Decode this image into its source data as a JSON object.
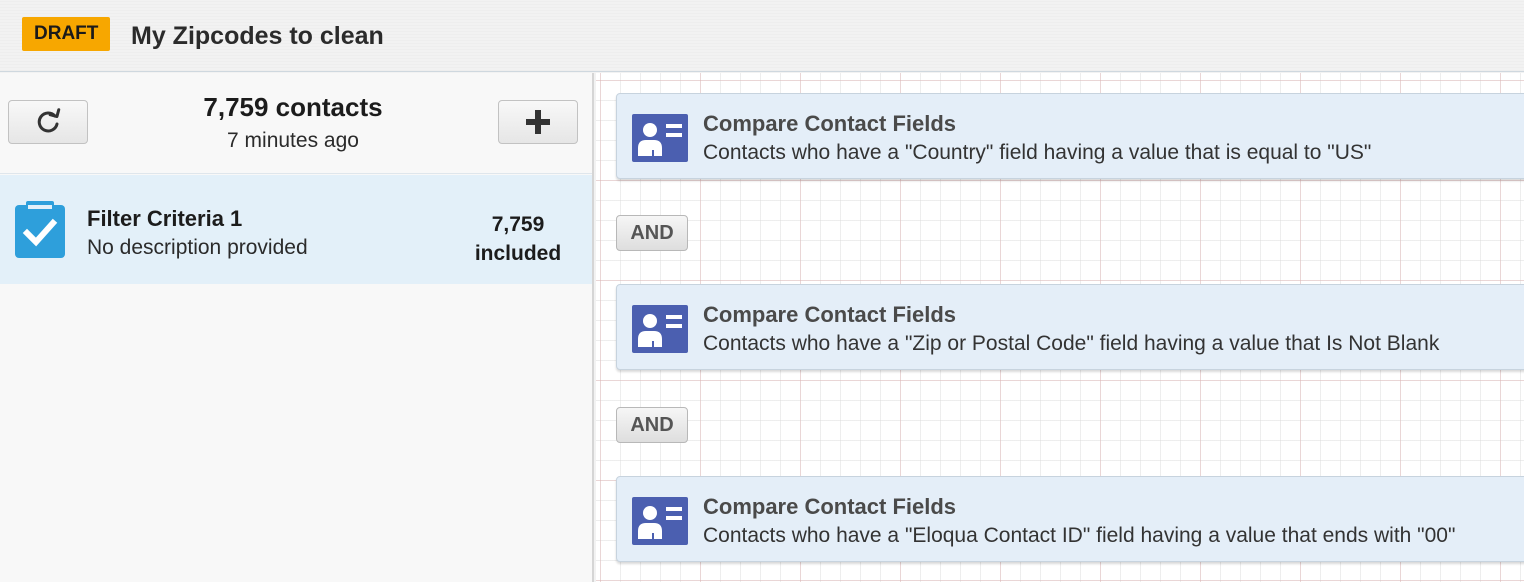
{
  "header": {
    "badge": "DRAFT",
    "title": "My Zipcodes to clean"
  },
  "summary": {
    "count": "7,759 contacts",
    "updated": "7 minutes ago",
    "refresh_icon": "refresh-icon",
    "add_icon": "plus-icon"
  },
  "criteria": [
    {
      "name": "Filter Criteria 1",
      "description": "No description provided",
      "count": "7,759",
      "count_label": "included",
      "icon": "clipboard-check-icon"
    }
  ],
  "canvas": {
    "cards": [
      {
        "title": "Compare Contact Fields",
        "description": "Contacts who have a \"Country\" field having a value that is equal to \"US\"",
        "icon": "contact-card-icon"
      },
      {
        "title": "Compare Contact Fields",
        "description": "Contacts who have a \"Zip or Postal Code\" field having a value that Is Not Blank",
        "icon": "contact-card-icon"
      },
      {
        "title": "Compare Contact Fields",
        "description": "Contacts who have a \"Eloqua Contact ID\" field having a value that ends with \"00\"",
        "icon": "contact-card-icon"
      }
    ],
    "operators": [
      "AND",
      "AND"
    ]
  },
  "colors": {
    "badge": "#f7a700",
    "selected_row": "#e3f0f9",
    "card_bg": "#e4eef8",
    "icon_blue": "#4b5fb0",
    "clip_blue": "#2e9fdb"
  }
}
